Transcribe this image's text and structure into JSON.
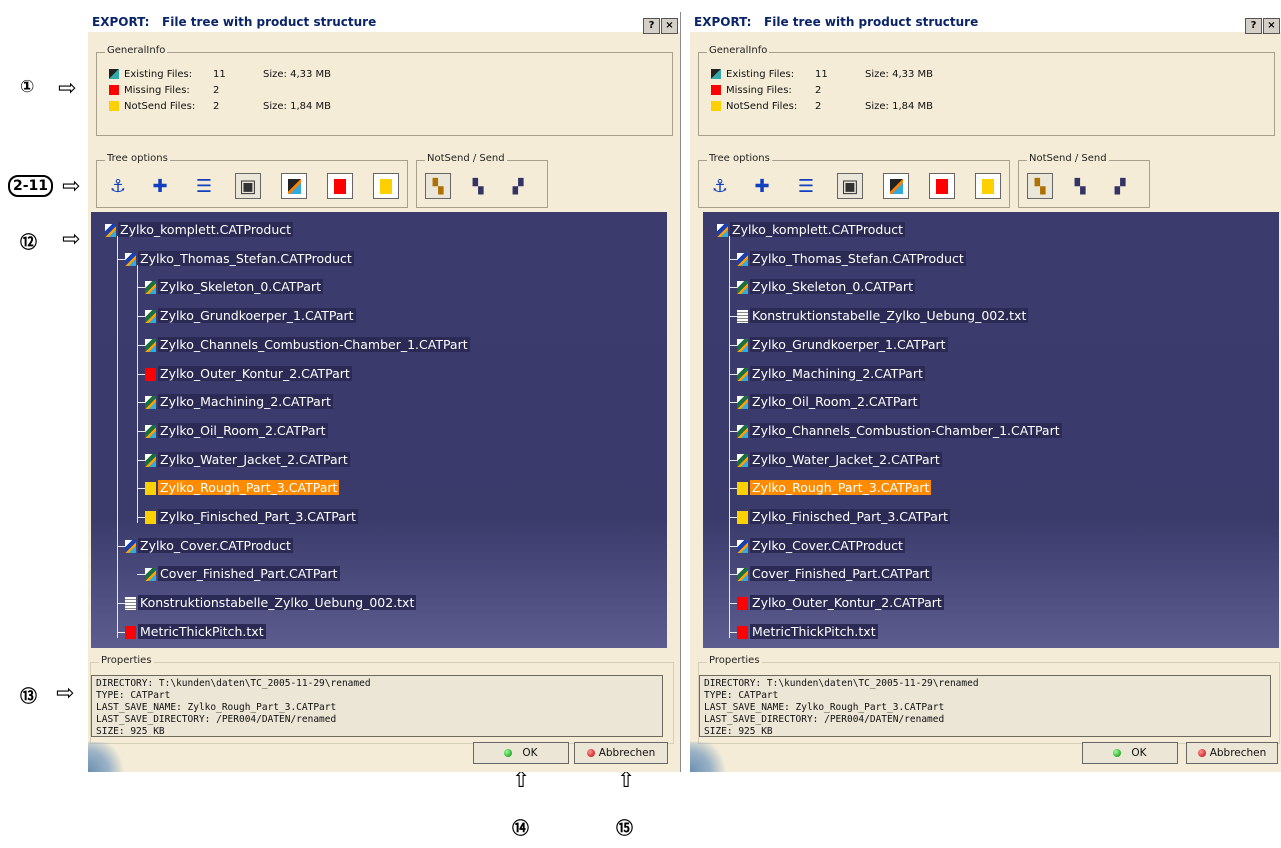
{
  "dialog_title_prefix": "EXPORT:",
  "dialog_title": "File tree with product structure",
  "title_buttons": {
    "help": "?",
    "close": "×"
  },
  "general_info": {
    "label": "GeneralInfo",
    "existing_label": "Existing Files:",
    "existing_count": "11",
    "existing_size": "Size: 4,33 MB",
    "missing_label": "Missing Files:",
    "missing_count": "2",
    "notsend_label": "NotSend Files:",
    "notsend_count": "2",
    "notsend_size": "Size: 1,84 MB"
  },
  "tree_options_label": "Tree options",
  "notsend_send_label": "NotSend / Send",
  "icons": {
    "anchor": "anchor-icon",
    "expand": "expand-all-icon",
    "collapse": "collapse-all-icon",
    "cube": "3d-view-icon",
    "existing": "existing-files-icon",
    "missing": "missing-files-icon",
    "notsend": "notsend-files-icon"
  },
  "colors": {
    "tree_bg": "#3b3b6e",
    "selected": "#ff8c00",
    "missing": "#ff0000",
    "notsend": "#ffd700"
  },
  "left_tree": [
    {
      "label": "Zylko_komplett.CATProduct",
      "icon": "product"
    },
    {
      "label": "Zylko_Thomas_Stefan.CATProduct",
      "icon": "product"
    },
    {
      "label": "Zylko_Skeleton_0.CATPart",
      "icon": "part"
    },
    {
      "label": "Zylko_Grundkoerper_1.CATPart",
      "icon": "part"
    },
    {
      "label": "Zylko_Channels_Combustion-Chamber_1.CATPart",
      "icon": "part"
    },
    {
      "label": "Zylko_Outer_Kontur_2.CATPart",
      "icon": "missing"
    },
    {
      "label": "Zylko_Machining_2.CATPart",
      "icon": "part"
    },
    {
      "label": "Zylko_Oil_Room_2.CATPart",
      "icon": "part"
    },
    {
      "label": "Zylko_Water_Jacket_2.CATPart",
      "icon": "part"
    },
    {
      "label": "Zylko_Rough_Part_3.CATPart",
      "icon": "notsend"
    },
    {
      "label": "Zylko_Finisched_Part_3.CATPart",
      "icon": "notsend"
    },
    {
      "label": "Zylko_Cover.CATProduct",
      "icon": "product"
    },
    {
      "label": "Cover_Finished_Part.CATPart",
      "icon": "part"
    },
    {
      "label": "Konstruktionstabelle_Zylko_Uebung_002.txt",
      "icon": "text"
    },
    {
      "label": "MetricThickPitch.txt",
      "icon": "missing"
    }
  ],
  "right_tree": [
    {
      "label": "Zylko_komplett.CATProduct",
      "icon": "product"
    },
    {
      "label": "Zylko_Thomas_Stefan.CATProduct",
      "icon": "product"
    },
    {
      "label": "Zylko_Skeleton_0.CATPart",
      "icon": "part"
    },
    {
      "label": "Konstruktionstabelle_Zylko_Uebung_002.txt",
      "icon": "text"
    },
    {
      "label": "Zylko_Grundkoerper_1.CATPart",
      "icon": "part"
    },
    {
      "label": "Zylko_Machining_2.CATPart",
      "icon": "part"
    },
    {
      "label": "Zylko_Oil_Room_2.CATPart",
      "icon": "part"
    },
    {
      "label": "Zylko_Channels_Combustion-Chamber_1.CATPart",
      "icon": "part"
    },
    {
      "label": "Zylko_Water_Jacket_2.CATPart",
      "icon": "part"
    },
    {
      "label": "Zylko_Rough_Part_3.CATPart",
      "icon": "notsend"
    },
    {
      "label": "Zylko_Finisched_Part_3.CATPart",
      "icon": "notsend"
    },
    {
      "label": "Zylko_Cover.CATProduct",
      "icon": "product"
    },
    {
      "label": "Cover_Finished_Part.CATPart",
      "icon": "part"
    },
    {
      "label": "Zylko_Outer_Kontur_2.CATPart",
      "icon": "missing"
    },
    {
      "label": "MetricThickPitch.txt",
      "icon": "missing"
    }
  ],
  "properties": {
    "label": "Properties",
    "lines": [
      "DIRECTORY: T:\\kunden\\daten\\TC_2005-11-29\\renamed",
      "TYPE: CATPart",
      "LAST_SAVE_NAME: Zylko_Rough_Part_3.CATPart",
      "LAST_SAVE_DIRECTORY: /PER004/DATEN/renamed",
      "SIZE: 925 KB"
    ]
  },
  "buttons": {
    "ok": "OK",
    "cancel": "Abbrechen"
  },
  "callouts": {
    "c1": "①",
    "c2": "2-11",
    "c12": "⑫",
    "c13": "⑬",
    "c14": "⑭",
    "c15": "⑮"
  },
  "arrow_glyph": "⇨",
  "arrow_up_glyph": "⇧"
}
